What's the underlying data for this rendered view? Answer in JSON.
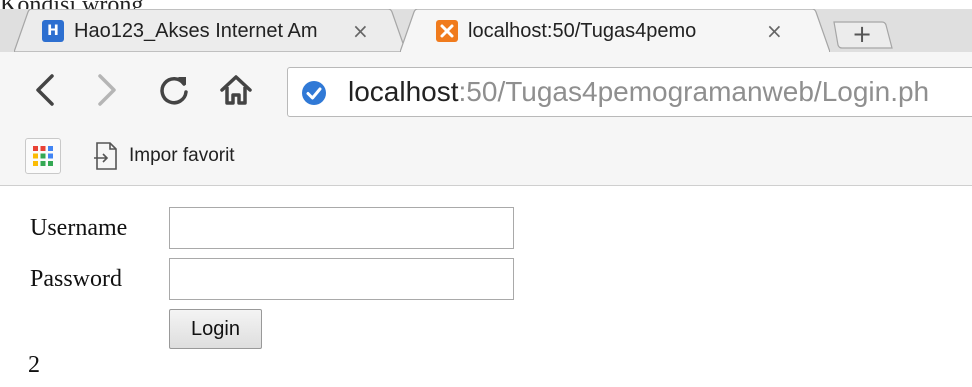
{
  "caption": "Kondisi wrong",
  "tabs": [
    {
      "title": "Hao123_Akses Internet Am",
      "close": "×",
      "favicon": "hao123-icon",
      "color": "#2d6fd0",
      "active": false
    },
    {
      "title": "localhost:50/Tugas4pemo",
      "close": "×",
      "favicon": "xampp-icon",
      "color": "#f07b1d",
      "active": true
    }
  ],
  "new_tab": "+",
  "toolbar": {
    "url_host": "localhost",
    "url_rest": ":50/Tugas4pemogramanweb/Login.ph"
  },
  "bookmarks": {
    "item_label": "Impor favorit"
  },
  "form": {
    "username_label": "Username",
    "password_label": "Password",
    "username_value": "",
    "password_value": "",
    "login_label": "Login"
  },
  "output": "2"
}
